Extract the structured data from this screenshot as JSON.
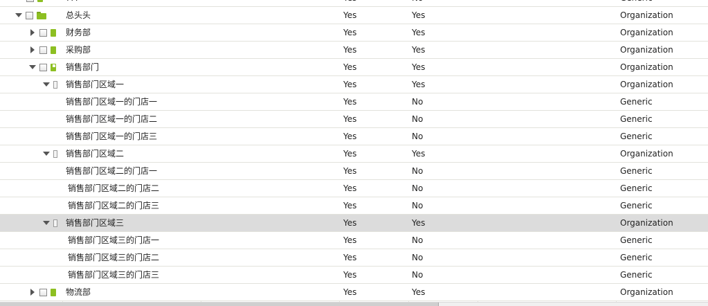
{
  "rows": [
    {
      "name": "???",
      "col2": "Yes",
      "col3": "No",
      "type": "Generic"
    },
    {
      "name": "总头头",
      "col2": "Yes",
      "col3": "Yes",
      "type": "Organization"
    },
    {
      "name": "财务部",
      "col2": "Yes",
      "col3": "Yes",
      "type": "Organization"
    },
    {
      "name": "采购部",
      "col2": "Yes",
      "col3": "Yes",
      "type": "Organization"
    },
    {
      "name": "销售部门",
      "col2": "Yes",
      "col3": "Yes",
      "type": "Organization"
    },
    {
      "name": "销售部门区域一",
      "col2": "Yes",
      "col3": "Yes",
      "type": "Organization"
    },
    {
      "name": "销售部门区域一的门店一",
      "col2": "Yes",
      "col3": "No",
      "type": "Generic"
    },
    {
      "name": "销售部门区域一的门店二",
      "col2": "Yes",
      "col3": "No",
      "type": "Generic"
    },
    {
      "name": "销售部门区域一的门店三",
      "col2": "Yes",
      "col3": "No",
      "type": "Generic"
    },
    {
      "name": "销售部门区域二",
      "col2": "Yes",
      "col3": "Yes",
      "type": "Organization"
    },
    {
      "name": "销售部门区域二的门店一",
      "col2": "Yes",
      "col3": "No",
      "type": "Generic"
    },
    {
      "name": "销售部门区域二的门店二",
      "col2": "Yes",
      "col3": "No",
      "type": "Generic"
    },
    {
      "name": "销售部门区域二的门店三",
      "col2": "Yes",
      "col3": "No",
      "type": "Generic"
    },
    {
      "name": "销售部门区域三",
      "col2": "Yes",
      "col3": "Yes",
      "type": "Organization"
    },
    {
      "name": "销售部门区域三的门店一",
      "col2": "Yes",
      "col3": "No",
      "type": "Generic"
    },
    {
      "name": "销售部门区域三的门店二",
      "col2": "Yes",
      "col3": "No",
      "type": "Generic"
    },
    {
      "name": "销售部门区域三的门店三",
      "col2": "Yes",
      "col3": "No",
      "type": "Generic"
    },
    {
      "name": "物流部",
      "col2": "Yes",
      "col3": "Yes",
      "type": "Organization"
    }
  ],
  "icons": {
    "expand": "triangle-right-icon",
    "collapse": "triangle-down-icon",
    "folder_open": "folder-open-icon",
    "leaf": "document-icon",
    "document_folder": "document-folder-icon",
    "blank_page": "blank-page-icon"
  },
  "colors": {
    "icon_green": "#8dbf22",
    "selected_row": "#dcdcdc",
    "grid_line": "#e2e2dc"
  }
}
